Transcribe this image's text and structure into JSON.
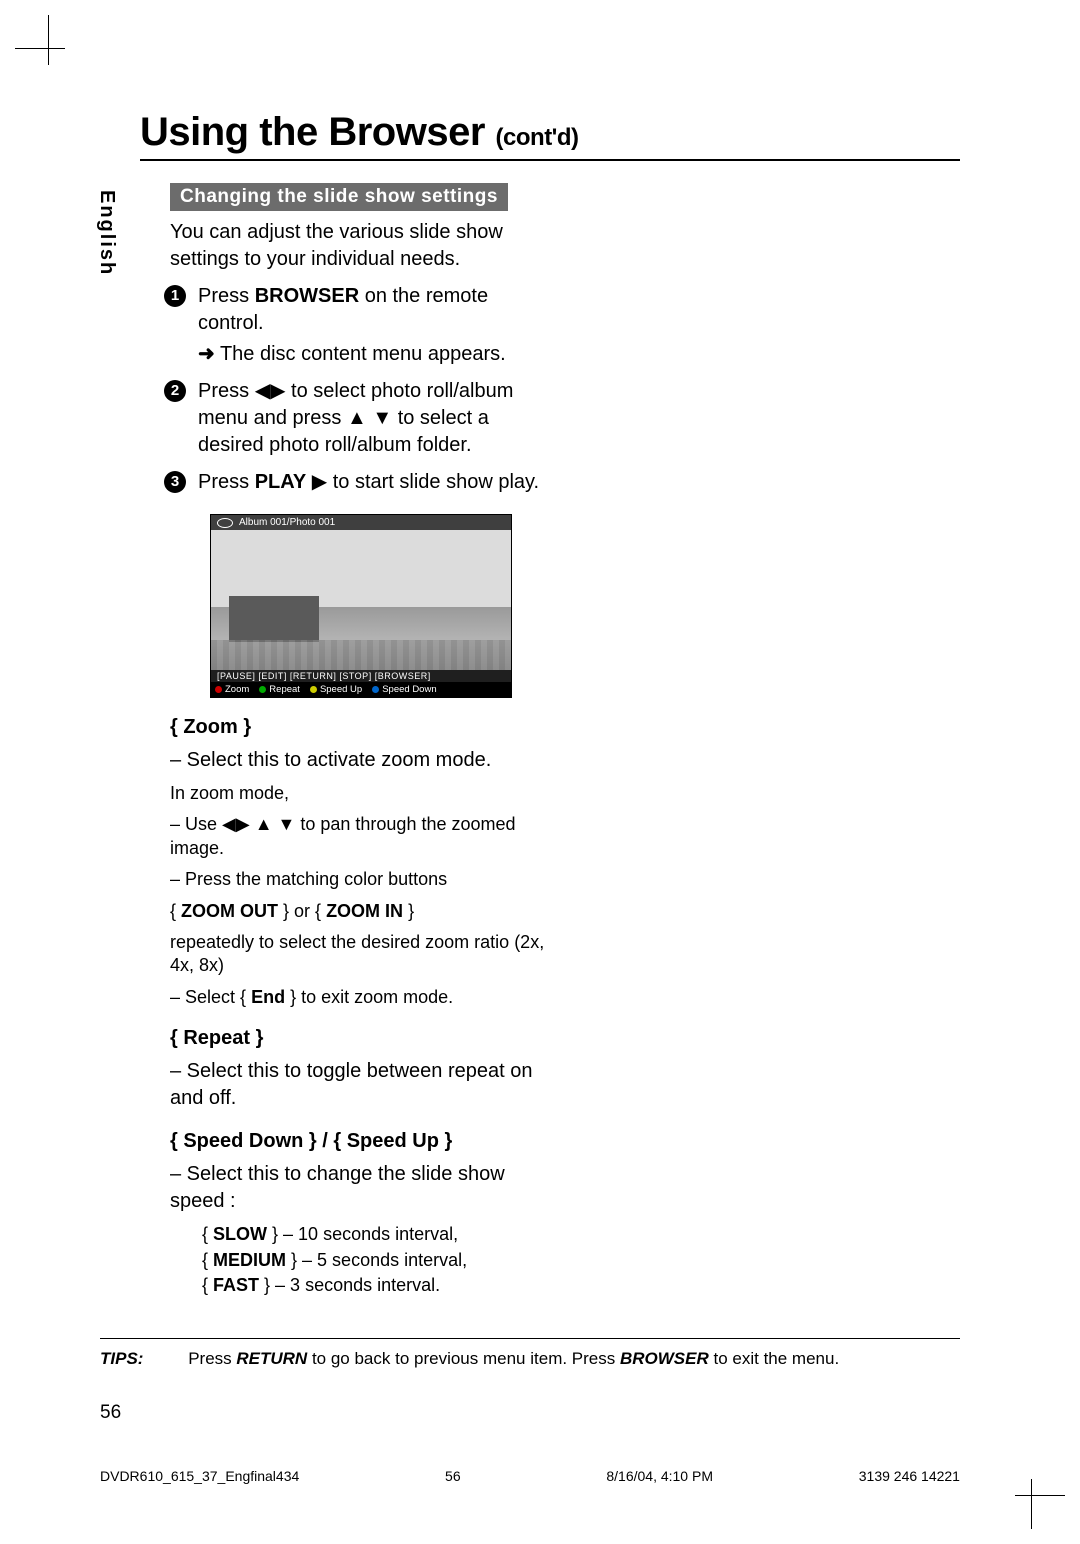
{
  "sidebar_lang": "English",
  "title_main": "Using the Browser",
  "title_suffix": "(cont'd)",
  "section_heading": "Changing the slide show settings",
  "intro": "You can adjust the various slide show settings to your individual needs.",
  "step1_a": "Press ",
  "step1_b_bold": "BROWSER",
  "step1_c": " on the remote control.",
  "step1_result": "The disc content menu appears.",
  "step2_a": "Press ",
  "step2_b": " to select photo roll/album menu and press ",
  "step2_c": " to select a desired photo roll/album folder.",
  "step3_a": "Press ",
  "step3_b_bold": "PLAY",
  "step3_c": "  to start slide show play.",
  "osd": {
    "header": "Album 001/Photo 001",
    "row1": "[PAUSE] [EDIT] [RETURN] [STOP] [BROWSER]",
    "zoom": "Zoom",
    "repeat": "Repeat",
    "speedup": "Speed Up",
    "speeddown": "Speed Down"
  },
  "zoom": {
    "head": "{ Zoom }",
    "line1": "–  Select this to activate zoom mode.",
    "line2": "In zoom mode,",
    "line3a": "–  Use ",
    "line3b": " to pan through the zoomed image.",
    "line4": "–  Press the matching color buttons",
    "line5_a": "{ ",
    "line5_b": "ZOOM OUT",
    "line5_c": " } or { ",
    "line5_d": "ZOOM IN",
    "line5_e": " }",
    "line6": "repeatedly to select the desired zoom ratio (2x, 4x, 8x)",
    "line7_a": "–  Select { ",
    "line7_b": "End",
    "line7_c": " } to exit zoom mode."
  },
  "repeat": {
    "head": "{ Repeat }",
    "line1": "–  Select this to toggle between repeat on and off."
  },
  "speed": {
    "head": "{ Speed Down } / { Speed Up }",
    "line1": "–  Select this to change the slide show speed :",
    "slow_a": "{ ",
    "slow_b": "SLOW",
    "slow_c": " } – 10 seconds interval,",
    "med_a": "{ ",
    "med_b": "MEDIUM",
    "med_c": " } – 5 seconds interval,",
    "fast_a": "{ ",
    "fast_b": "FAST",
    "fast_c": " } – 3 seconds interval."
  },
  "tips_label": "TIPS:",
  "tips_a": "Press ",
  "tips_b": "RETURN",
  "tips_c": " to go back to previous menu item.  Press ",
  "tips_d": "BROWSER",
  "tips_e": " to exit the menu.",
  "page_number": "56",
  "footer_left": "DVDR610_615_37_Engfinal434",
  "footer_mid": "56",
  "footer_date": "8/16/04, 4:10 PM",
  "footer_right": "3139 246 14221"
}
